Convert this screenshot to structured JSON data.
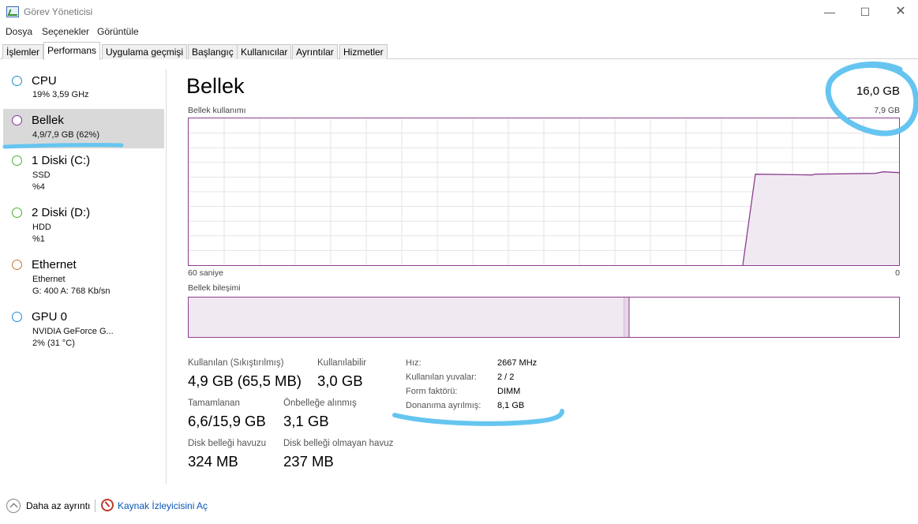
{
  "window": {
    "title": "Görev Yöneticisi"
  },
  "menu": [
    "Dosya",
    "Seçenekler",
    "Görüntüle"
  ],
  "tabs": [
    "İşlemler",
    "Performans",
    "Uygulama geçmişi",
    "Başlangıç",
    "Kullanıcılar",
    "Ayrıntılar",
    "Hizmetler"
  ],
  "active_tab": "Performans",
  "sidebar": {
    "items": [
      {
        "name": "CPU",
        "sub1": "19%  3,59 GHz",
        "sub2": "",
        "color": "#1e8ad6"
      },
      {
        "name": "Bellek",
        "sub1": "4,9/7,9 GB (62%)",
        "sub2": "",
        "color": "#8b2f9c"
      },
      {
        "name": "1 Diski (C:)",
        "sub1": "SSD",
        "sub2": "%4",
        "color": "#4caf2e"
      },
      {
        "name": "2 Diski (D:)",
        "sub1": "HDD",
        "sub2": "%1",
        "color": "#4caf2e"
      },
      {
        "name": "Ethernet",
        "sub1": "Ethernet",
        "sub2": "G: 400  A: 768 Kb/sn",
        "color": "#c8742a"
      },
      {
        "name": "GPU 0",
        "sub1": "NVIDIA GeForce G...",
        "sub2": "2% (31 °C)",
        "color": "#1e8ad6"
      }
    ]
  },
  "main": {
    "title": "Bellek",
    "total": "16,0 GB",
    "usage_label": "Bellek kullanımı",
    "usage_max": "7,9 GB",
    "time_left": "60 saniye",
    "time_right": "0",
    "composition_label": "Bellek bileşimi"
  },
  "stats": {
    "used_label": "Kullanılan (Sıkıştırılmış)",
    "used_value": "4,9 GB (65,5 MB)",
    "available_label": "Kullanılabilir",
    "available_value": "3,0 GB",
    "committed_label": "Tamamlanan",
    "committed_value": "6,6/15,9 GB",
    "cached_label": "Önbelleğe alınmış",
    "cached_value": "3,1 GB",
    "paged_label": "Disk belleği havuzu",
    "paged_value": "324 MB",
    "nonpaged_label": "Disk belleği olmayan havuz",
    "nonpaged_value": "237 MB"
  },
  "specs": {
    "speed_label": "Hız:",
    "speed_value": "2667 MHz",
    "slots_label": "Kullanılan yuvalar:",
    "slots_value": "2 / 2",
    "form_label": "Form faktörü:",
    "form_value": "DIMM",
    "reserved_label": "Donanıma ayrılmış:",
    "reserved_value": "8,1 GB"
  },
  "footer": {
    "fewer_details": "Daha az ayrıntı",
    "resource_monitor": "Kaynak İzleyicisini Aç"
  },
  "memory_graph": {
    "usage_fraction_recent": 0.62,
    "composition_in_use_fraction": 0.62
  },
  "colors": {
    "memory": "#8b3e8e",
    "memory_fill": "#f1e9f2",
    "grid": "#e9e1ea",
    "annotation": "#66c5f0"
  }
}
